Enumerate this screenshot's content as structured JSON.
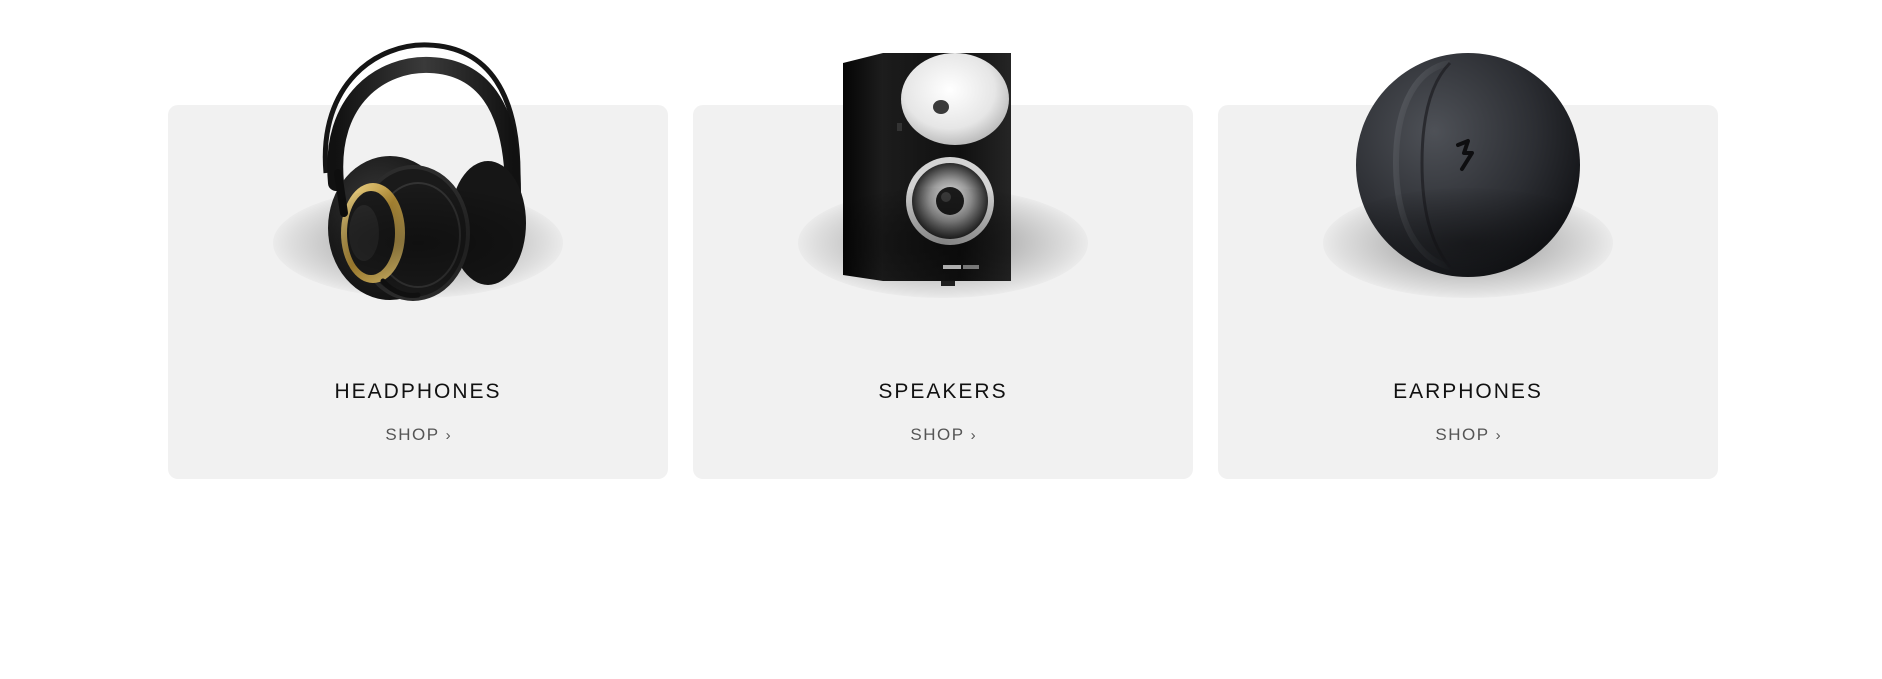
{
  "categories": [
    {
      "title": "HEADPHONES",
      "link_label": "SHOP",
      "chevron": "›",
      "image": "headphones-image"
    },
    {
      "title": "SPEAKERS",
      "link_label": "SHOP",
      "chevron": "›",
      "image": "speaker-image"
    },
    {
      "title": "EARPHONES",
      "link_label": "SHOP",
      "chevron": "›",
      "image": "earphones-case-image"
    }
  ],
  "colors": {
    "card_background": "#f1f1f1",
    "title_text": "#111111",
    "link_text": "#555555",
    "page_background": "#ffffff",
    "headphone_accent_gold": "#c9a84c"
  }
}
